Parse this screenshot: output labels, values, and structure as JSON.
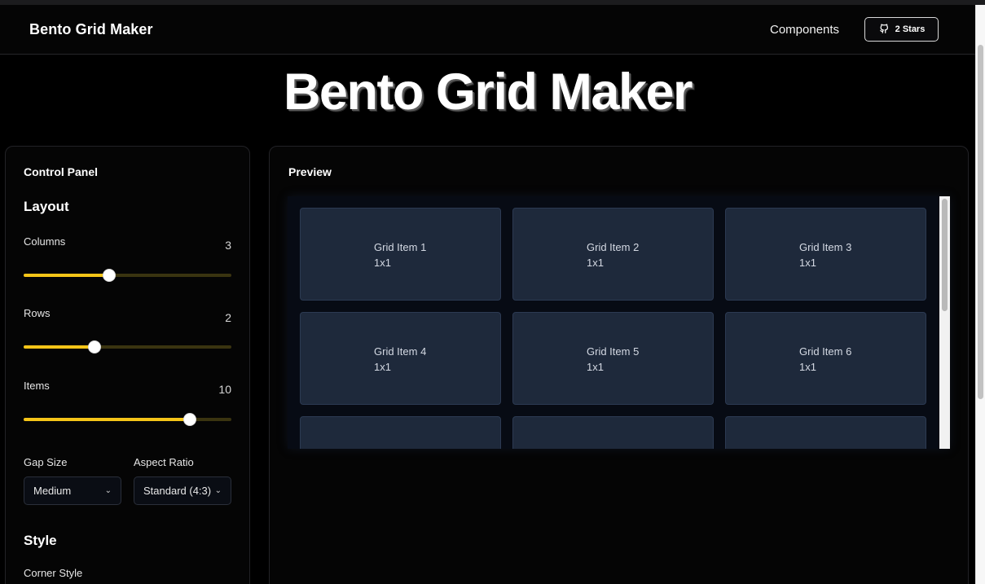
{
  "nav": {
    "brand": "Bento Grid Maker",
    "link": "Components",
    "stars_label": "2 Stars",
    "stars_icon": "github-icon"
  },
  "hero": {
    "title": "Bento Grid Maker"
  },
  "control_panel": {
    "title": "Control Panel",
    "layout_heading": "Layout",
    "sliders": [
      {
        "label": "Columns",
        "value": "3",
        "fill_percent": 41
      },
      {
        "label": "Rows",
        "value": "2",
        "fill_percent": 34
      },
      {
        "label": "Items",
        "value": "10",
        "fill_percent": 80
      }
    ],
    "gap_size": {
      "label": "Gap Size",
      "value": "Medium"
    },
    "aspect_ratio": {
      "label": "Aspect Ratio",
      "value": "Standard (4:3)"
    },
    "style_heading": "Style",
    "corner_style_label": "Corner Style"
  },
  "preview": {
    "title": "Preview",
    "items": [
      {
        "name": "Grid Item 1",
        "size": "1x1"
      },
      {
        "name": "Grid Item 2",
        "size": "1x1"
      },
      {
        "name": "Grid Item 3",
        "size": "1x1"
      },
      {
        "name": "Grid Item 4",
        "size": "1x1"
      },
      {
        "name": "Grid Item 5",
        "size": "1x1"
      },
      {
        "name": "Grid Item 6",
        "size": "1x1"
      },
      {
        "name": "",
        "size": ""
      },
      {
        "name": "",
        "size": ""
      },
      {
        "name": "",
        "size": ""
      }
    ]
  },
  "colors": {
    "accent": "#f5c518",
    "grid_item_bg": "#1e293b",
    "background": "#000000"
  }
}
